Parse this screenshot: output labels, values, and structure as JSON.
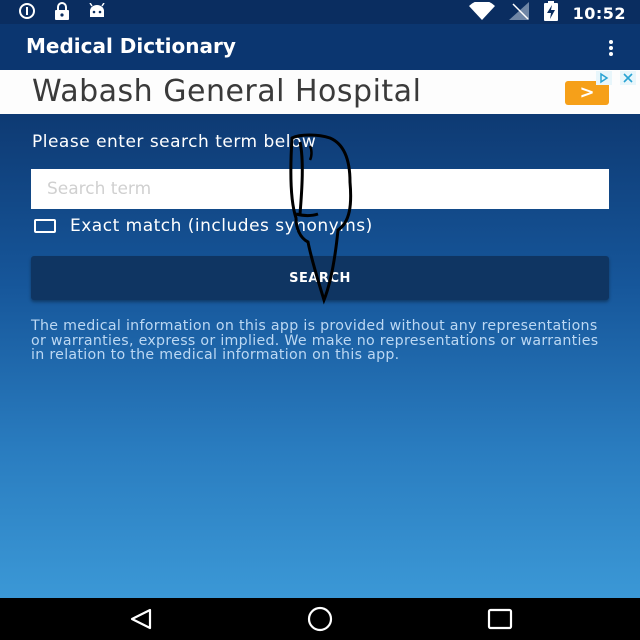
{
  "status_bar": {
    "time": "10:52",
    "left_icons": [
      "info-icon",
      "lock-icon",
      "android-icon"
    ],
    "right_icons": [
      "wifi-icon",
      "no-signal-icon",
      "battery-charging-icon"
    ]
  },
  "app_bar": {
    "title": "Medical Dictionary",
    "menu_icon": "overflow-menu-icon"
  },
  "ad": {
    "text": "Wabash General Hospital",
    "cta_symbol": ">",
    "cta_color": "#f6a019"
  },
  "search": {
    "prompt": "Please enter search term below",
    "placeholder": "Search term",
    "value": "",
    "exact_match_label": "Exact match (includes synonyms)",
    "exact_match_checked": false,
    "button_label": "SEARCH"
  },
  "disclaimer": "The medical information on this app is provided without any representations or warranties, express or implied. We make no representations or warranties in relation to the medical information on this app.",
  "nav_bar": {
    "buttons": [
      "back-icon",
      "home-icon",
      "recents-icon"
    ]
  },
  "colors": {
    "status_bar": "#0a2d60",
    "app_bar": "#0b3670",
    "button": "#0f3562",
    "accent": "#f6a019"
  }
}
